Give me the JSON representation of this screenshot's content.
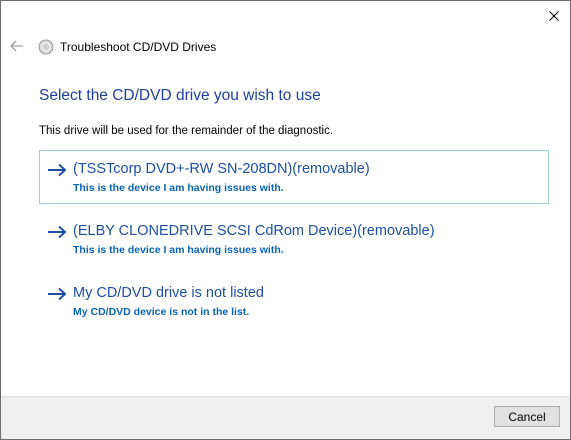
{
  "window": {
    "title": "Troubleshoot CD/DVD Drives"
  },
  "main": {
    "heading": "Select the CD/DVD drive you wish to use",
    "description": "This drive will be used for the remainder of the diagnostic.",
    "options": [
      {
        "title": "(TSSTcorp DVD+-RW SN-208DN)(removable)",
        "desc": "This is the device I am having issues with.",
        "selected": true
      },
      {
        "title": "(ELBY CLONEDRIVE SCSI CdRom Device)(removable)",
        "desc": "This is the device I am having issues with.",
        "selected": false
      },
      {
        "title": "My CD/DVD drive is not listed",
        "desc": "My CD/DVD device is not in the list.",
        "selected": false
      }
    ]
  },
  "footer": {
    "cancel_label": "Cancel"
  },
  "icons": {
    "close": "close-icon",
    "back": "back-arrow-icon",
    "app": "disc-icon",
    "option_arrow": "arrow-right-icon"
  },
  "colors": {
    "heading": "#1f3f9f",
    "link": "#1d4fa5",
    "desc": "#0a63b5",
    "selected_border": "#9ec9e4",
    "footer_bg": "#f0f0f0"
  }
}
